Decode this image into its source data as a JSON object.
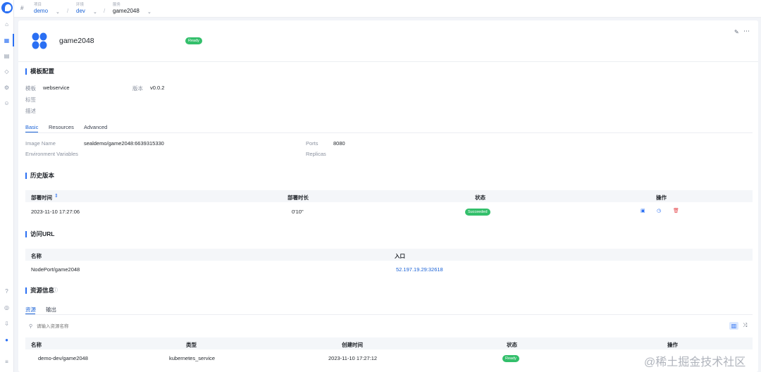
{
  "breadcrumb": [
    {
      "label": "项目",
      "value": "demo"
    },
    {
      "label": "环境",
      "value": "dev"
    },
    {
      "label": "服务",
      "value": "game2048"
    }
  ],
  "service": {
    "name": "game2048",
    "status": "Ready"
  },
  "template_section": {
    "title": "模板配置",
    "template_label": "模板",
    "template_value": "webservice",
    "version_label": "版本",
    "version_value": "v0.0.2",
    "tags_label": "标签",
    "desc_label": "描述"
  },
  "config_tabs": [
    "Basic",
    "Resources",
    "Advanced"
  ],
  "basic": {
    "image_name_label": "Image Name",
    "image_name_value": "sealdemo/game2048:6639315330",
    "env_label": "Environment Variables",
    "ports_label": "Ports",
    "ports_value": "8080",
    "replicas_label": "Replicas"
  },
  "history": {
    "title": "历史版本",
    "columns": [
      "部署时间",
      "部署时长",
      "状态",
      "操作"
    ],
    "rows": [
      {
        "time": "2023-11-10 17:27:06",
        "duration": "0'10\"",
        "status": "Succeeded"
      }
    ]
  },
  "urls": {
    "title": "访问URL",
    "columns": [
      "名称",
      "入口"
    ],
    "rows": [
      {
        "name": "NodePort/game2048",
        "entry": "52.197.19.29:32618"
      }
    ]
  },
  "resources": {
    "title": "资源信息",
    "tabs": [
      "资源",
      "输出"
    ],
    "search_placeholder": "请输入资源名称",
    "columns": [
      "名称",
      "类型",
      "创建时间",
      "状态",
      "操作"
    ],
    "rows": [
      {
        "name": "demo-dev/game2048",
        "type": "kubernetes_service",
        "created": "2023-11-10 17:27:12",
        "status": "Ready"
      }
    ]
  },
  "watermark": "@稀土掘金技术社区",
  "colors": {
    "accent": "#2a6ff3",
    "success": "#33bf6b",
    "delete": "#e5484d"
  }
}
